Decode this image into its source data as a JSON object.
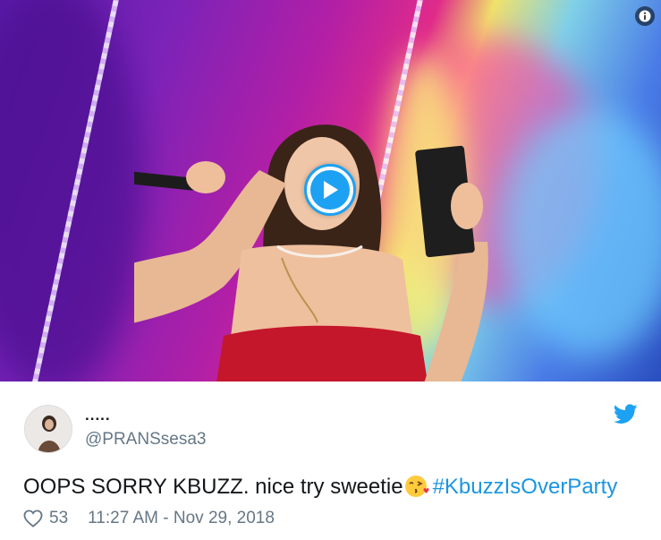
{
  "media": {
    "play_icon": "play-icon",
    "info_icon": "info-icon"
  },
  "tweet": {
    "display_name": ".....",
    "handle": "@PRANSsesa3",
    "text_main": "OOPS SORRY KBUZZ. nice try sweetie",
    "emoji": "face-blowing-a-kiss",
    "hashtag": "#KbuzzIsOverParty",
    "like_count": "53",
    "timestamp": "11:27 AM - Nov 29, 2018",
    "colors": {
      "accent": "#1da1f2",
      "link": "#1b95e0",
      "muted": "#657786",
      "text": "#14171a"
    }
  }
}
